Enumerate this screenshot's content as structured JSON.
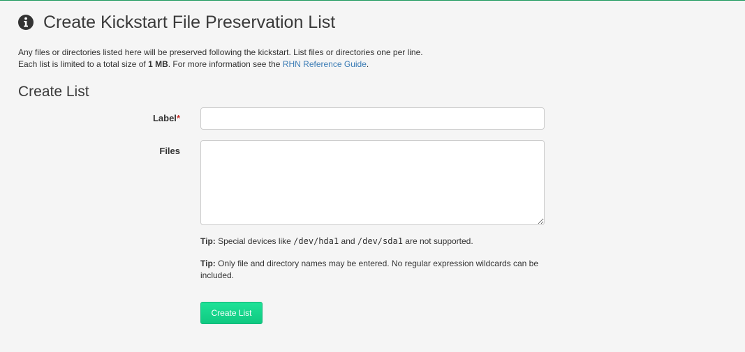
{
  "header": {
    "icon": "info-circle-icon",
    "title": "Create Kickstart File Preservation List"
  },
  "intro": {
    "line1": "Any files or directories listed here will be preserved following the kickstart. List files or directories one per line.",
    "line2_prefix": "Each list is limited to a total size of ",
    "line2_size": "1 MB",
    "line2_middle": ". For more information see the ",
    "line2_link": "RHN Reference Guide",
    "line2_suffix": "."
  },
  "form": {
    "section_title": "Create List",
    "label_field": {
      "label": "Label",
      "required_mark": "*",
      "value": ""
    },
    "files_field": {
      "label": "Files",
      "value": ""
    },
    "tip1": {
      "prefix": "Tip:",
      "text_a": " Special devices like ",
      "code_a": "/dev/hda1",
      "text_b": " and ",
      "code_b": "/dev/sda1",
      "text_c": " are not supported."
    },
    "tip2": {
      "prefix": "Tip:",
      "text": " Only file and directory names may be entered. No regular expression wildcards can be included."
    },
    "submit_label": "Create List"
  },
  "colors": {
    "accent_top_border": "#1d9a5e",
    "button": "#14c987",
    "link": "#3b7cb5",
    "required": "#c9302c"
  }
}
